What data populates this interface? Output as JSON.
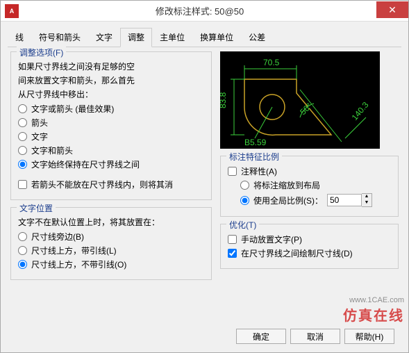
{
  "titlebar": {
    "app_icon": "A",
    "title": "修改标注样式: 50@50",
    "close": "✕"
  },
  "tabs": {
    "items": [
      "线",
      "符号和箭头",
      "文字",
      "调整",
      "主单位",
      "换算单位",
      "公差"
    ],
    "active_index": 3
  },
  "fit_options": {
    "title": "调整选项(F)",
    "desc1": "如果尺寸界线之间没有足够的空",
    "desc2": "间来放置文字和箭头，那么首先",
    "desc3": "从尺寸界线中移出：",
    "opts": [
      "文字或箭头 (最佳效果)",
      "箭头",
      "文字",
      "文字和箭头",
      "文字始终保持在尺寸界线之间"
    ],
    "selected": 4,
    "suppress_check": "若箭头不能放在尺寸界线内，则将其消"
  },
  "text_placement": {
    "title": "文字位置",
    "desc": "文字不在默认位置上时，将其放置在：",
    "opts": [
      "尺寸线旁边(B)",
      "尺寸线上方，带引线(L)",
      "尺寸线上方，不带引线(O)"
    ],
    "selected": 2
  },
  "preview_dims": {
    "top": "70.5",
    "left": "83.8",
    "diag": "140.3",
    "radius": "B5.59",
    "angle": "50°"
  },
  "scale": {
    "title": "标注特征比例",
    "annotative": "注释性(A)",
    "opt_layout": "将标注缩放到布局",
    "opt_global": "使用全局比例(S)：",
    "selected": 1,
    "global_value": "50"
  },
  "fine_tune": {
    "title": "优化(T)",
    "manual": "手动放置文字(P)",
    "draw_dim": "在尺寸界线之间绘制尺寸线(D)",
    "manual_checked": false,
    "draw_dim_checked": true
  },
  "buttons": {
    "ok": "确定",
    "cancel": "取消",
    "help": "帮助(H)"
  },
  "watermark": {
    "url": "www.1CAE.com",
    "brand": "仿真在线"
  }
}
